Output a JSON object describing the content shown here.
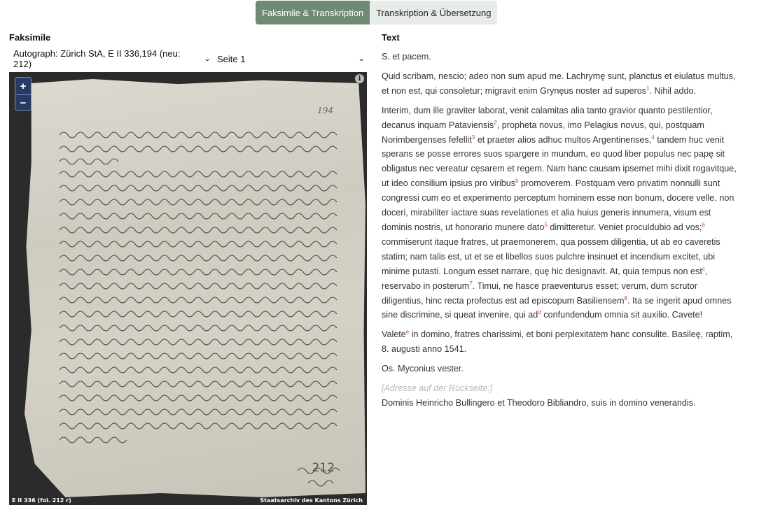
{
  "tabs": [
    {
      "label": "Faksimile & Transkription",
      "active": true
    },
    {
      "label": "Transkription & Übersetzung",
      "active": false
    }
  ],
  "left": {
    "heading": "Faksimile",
    "doc_select": "Autograph: Zürich StA, E II 336,194 (neu: 212)",
    "page_select": "Seite 1",
    "zoom_in": "+",
    "zoom_out": "−",
    "info": "i",
    "footer_left": "E II 336 (fol. 212 r)",
    "footer_right": "Staatsarchiv des Kantons Zürich",
    "page_number_mark": "212",
    "folio_mark": "194"
  },
  "right": {
    "heading": "Text",
    "greeting": "S. et pacem.",
    "p1_a": "Quid scribam, nescio; adeo non sum apud me. Lachrymę sunt, planctus et eiulatus multus, et non est, qui consoletur; migravit enim Grynęus noster ad superos",
    "p1_n1": "1",
    "p1_b": ". Nihil addo.",
    "p2_a": "Interim, dum ille graviter laborat, venit calamitas alia tanto gravior quanto pestilentior, decanus inquam Pataviensis",
    "p2_n2": "2",
    "p2_b": ", propheta novus, imo Pelagius novus, qui, postquam Norimbergenses fefellit",
    "p2_n3": "3",
    "p2_c": " et praeter alios adhuc multos Argentinenses,",
    "p2_n4": "4",
    "p2_d": " tandem huc venit sperans se posse errores suos spargere in mundum, eo quod liber populus nec papę sit obligatus nec vereatur cęsarem et regem. Nam hanc causam ipsemet mihi dixit rogavitque, ut ideo consilium ipsius pro viribus",
    "p2_nb": "b",
    "p2_e": " promoverem. Postquam vero privatim nonnulli sunt congressi cum eo et experimento perceptum hominem esse non bonum, docere velle, non doceri, mirabiliter iactare suas revelationes et alia huius generis innumera, visum est dominis nostris, ut honorario munere dato",
    "p2_n5": "5",
    "p2_f": " dimitteretur. Veniet proculdubio ad vos;",
    "p2_n6": "6",
    "p2_g": " commiserunt itaque fratres, ut praemonerem, qua possem diligentia, ut ab eo caveretis statim; nam talis est, ut et se et libellos suos pulchre insinuet et incendium excitet, ubi minime putasti. Longum esset narrare, quę hic designavit. At, quia tempus non est",
    "p2_nc": "c",
    "p2_h": ", reservabo in posterum",
    "p2_n7": "7",
    "p2_i": ". Timui, ne hasce praeventurus esset; verum, dum scrutor diligentius, hinc recta profectus est ad episcopum Basiliensem",
    "p2_n8": "8",
    "p2_j": ". Ita se ingerit apud omnes sine discrimine, si queat invenire, qui ad",
    "p2_nd": "d",
    "p2_k": " confundendum omnia sit auxilio. Cavete!",
    "p3_a": "Valete",
    "p3_ne": "e",
    "p3_b": " in domino, fratres charissimi, et boni perplexitatem hanc consulite. Basileę, raptim, 8. augusti anno 1541.",
    "closing": "Os. Myconius vester.",
    "address_label": "[Adresse auf der Rückseite:]",
    "address": "Dominis Heinricho Bullingero et Theodoro Bibliandro, suis in domino venerandis."
  }
}
